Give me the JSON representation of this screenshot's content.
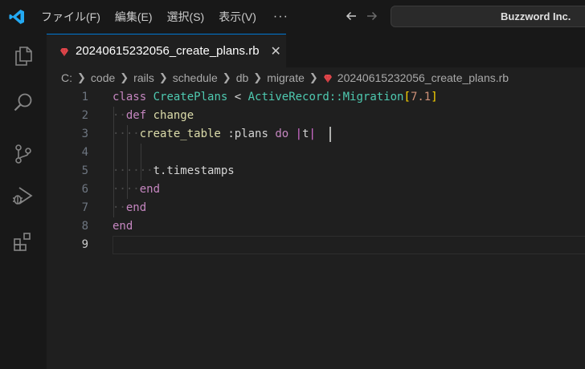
{
  "titlebar": {
    "menu": [
      "ファイル(F)",
      "編集(E)",
      "選択(S)",
      "表示(V)"
    ],
    "more": "···",
    "command_center": "Buzzword Inc."
  },
  "icons": {
    "logo": "vscode-logo-icon",
    "back": "arrow-left-icon",
    "forward": "arrow-right-icon",
    "activity": [
      "explorer-icon",
      "search-icon",
      "source-control-icon",
      "run-debug-icon",
      "extensions-icon"
    ],
    "file": "ruby-file-icon",
    "close": "close-icon"
  },
  "colors": {
    "accent": "#0078d4",
    "ruby": "#e5484d",
    "keyword": "#c586c0",
    "class": "#4ec9b0",
    "function": "#dcdcaa"
  },
  "tab": {
    "label": "20240615232056_create_plans.rb",
    "close": "✕"
  },
  "breadcrumb": [
    "C:",
    "code",
    "rails",
    "schedule",
    "db",
    "migrate",
    "20240615232056_create_plans.rb"
  ],
  "editor": {
    "line_numbers": [
      "1",
      "2",
      "3",
      "4",
      "5",
      "6",
      "7",
      "8",
      "9"
    ],
    "active_line": 9,
    "line1": {
      "kw": "class",
      "cls": "CreatePlans",
      "op": "<",
      "cls2": "ActiveRecord::Migration",
      "open": "[",
      "num": "7.1",
      "close": "]"
    },
    "line2": {
      "ws": "··",
      "kw": "def",
      "fn": "change"
    },
    "line3": {
      "ws": "····",
      "fn": "create_table",
      "sym": ":plans",
      "kw": "do",
      "pipe1": "|",
      "var": "t",
      "pipe2": "|"
    },
    "line5": {
      "ws": "······",
      "text": "t.timestamps"
    },
    "line6": {
      "ws": "····",
      "kw": "end"
    },
    "line7": {
      "ws": "··",
      "kw": "end"
    },
    "line8": {
      "kw": "end"
    }
  }
}
